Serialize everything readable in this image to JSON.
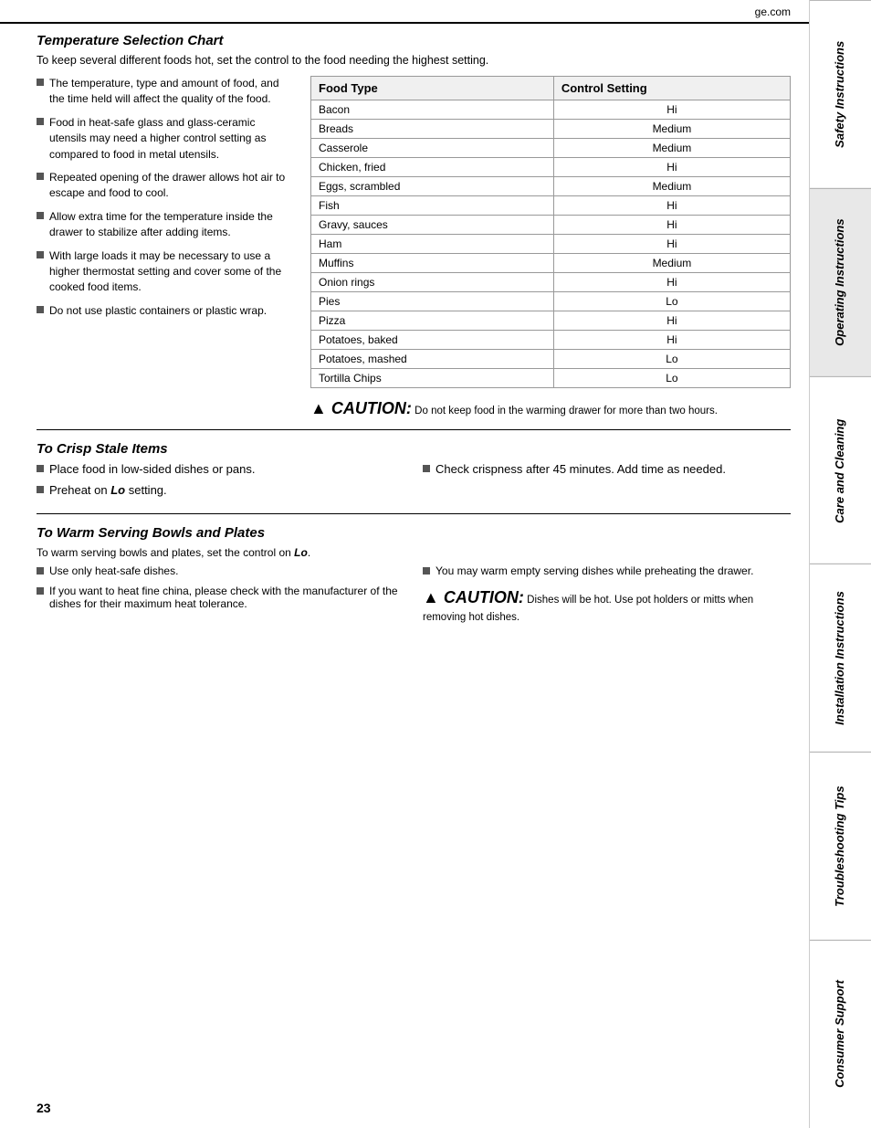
{
  "site": "ge.com",
  "page_number": "23",
  "temp_section": {
    "title": "Temperature Selection Chart",
    "subtitle": "To keep several different foods hot, set the control to the food needing the highest setting.",
    "bullets": [
      "The temperature, type and amount of food, and the time held will affect the quality of the food.",
      "Food in heat-safe glass and glass-ceramic utensils may need a higher control setting as compared to food in metal utensils.",
      "Repeated opening of the drawer allows hot air to escape and food to cool.",
      "Allow extra time for the temperature inside the drawer to stabilize after adding items.",
      "With large loads it may be necessary to use a higher thermostat setting and cover some of the cooked food items.",
      "Do not use plastic containers or plastic wrap."
    ],
    "table": {
      "col1": "Food Type",
      "col2": "Control Setting",
      "rows": [
        {
          "food": "Bacon",
          "setting": "Hi"
        },
        {
          "food": "Breads",
          "setting": "Medium"
        },
        {
          "food": "Casserole",
          "setting": "Medium"
        },
        {
          "food": "Chicken, fried",
          "setting": "Hi"
        },
        {
          "food": "Eggs, scrambled",
          "setting": "Medium"
        },
        {
          "food": "Fish",
          "setting": "Hi"
        },
        {
          "food": "Gravy, sauces",
          "setting": "Hi"
        },
        {
          "food": "Ham",
          "setting": "Hi"
        },
        {
          "food": "Muffins",
          "setting": "Medium"
        },
        {
          "food": "Onion rings",
          "setting": "Hi"
        },
        {
          "food": "Pies",
          "setting": "Lo"
        },
        {
          "food": "Pizza",
          "setting": "Hi"
        },
        {
          "food": "Potatoes, baked",
          "setting": "Hi"
        },
        {
          "food": "Potatoes, mashed",
          "setting": "Lo"
        },
        {
          "food": "Tortilla Chips",
          "setting": "Lo"
        }
      ]
    },
    "caution_label": "CAUTION:",
    "caution_text": "Do not keep food in the warming drawer for more than two hours."
  },
  "crisp_section": {
    "title": "To Crisp Stale Items",
    "left_bullets": [
      "Place food in low-sided dishes or pans.",
      "Preheat on Lo setting."
    ],
    "right_bullets": [
      "Check crispness after 45 minutes. Add time as needed."
    ],
    "lo_label": "Lo"
  },
  "warm_section": {
    "title": "To Warm Serving Bowls and Plates",
    "intro": "To warm serving bowls and plates, set the control on Lo.",
    "lo_label": "Lo",
    "left_bullets": [
      "Use only heat-safe dishes.",
      "If you want to heat fine china, please check with the manufacturer of the dishes for their maximum heat tolerance."
    ],
    "right_bullets": [
      "You may warm empty serving dishes while preheating the drawer."
    ],
    "caution_label": "CAUTION:",
    "caution_text": "Dishes will be hot. Use pot holders or mitts when removing hot dishes."
  },
  "sidebar": {
    "tabs": [
      "Safety Instructions",
      "Operating Instructions",
      "Care and Cleaning",
      "Installation Instructions",
      "Troubleshooting Tips",
      "Consumer Support"
    ]
  }
}
